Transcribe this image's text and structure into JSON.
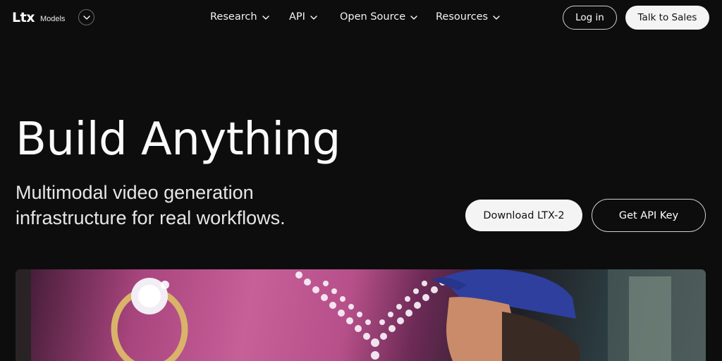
{
  "brand": {
    "logo_text": "Ltx",
    "sub_label": "Models"
  },
  "nav": {
    "items": [
      {
        "label": "Research"
      },
      {
        "label": "API"
      },
      {
        "label": "Open Source"
      },
      {
        "label": "Resources"
      }
    ],
    "login_label": "Log in",
    "sales_label": "Talk to Sales"
  },
  "hero": {
    "title": "Build Anything",
    "subtitle": "Multimodal video generation infrastructure for real workflows.",
    "download_label": "Download LTX-2",
    "api_key_label": "Get API Key"
  },
  "colors": {
    "background": "#0d0d0d",
    "text": "#ffffff",
    "button_light": "#f4f4f4",
    "button_dark_text": "#111111"
  },
  "icons": {
    "brand_toggle": "chevron-down-icon",
    "menu_chevron": "chevron-down-icon"
  }
}
